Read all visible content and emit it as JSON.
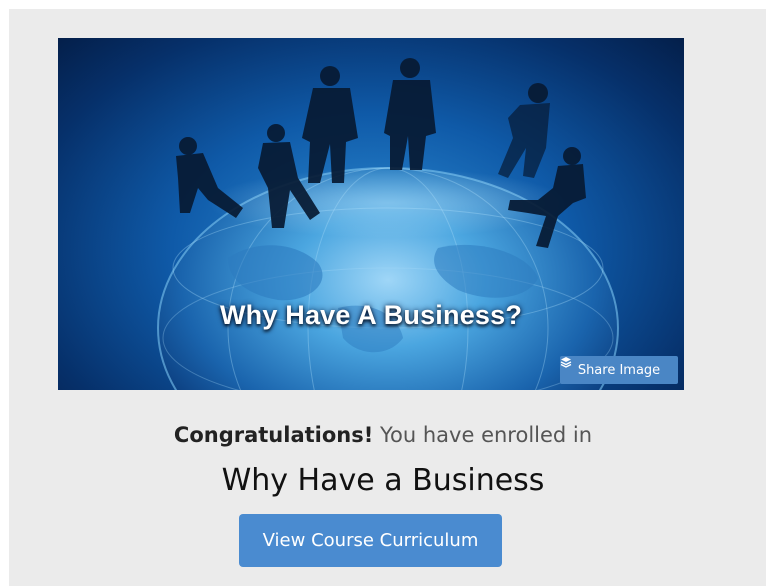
{
  "hero": {
    "caption": "Why Have A Business?",
    "share_label": "Share Image",
    "share_icon": "layers-icon"
  },
  "enrollment": {
    "congrats_strong": "Congratulations!",
    "congrats_rest": " You have enrolled in",
    "course_title": "Why Have a Business",
    "curriculum_button": "View Course Curriculum"
  },
  "colors": {
    "panel_bg": "#ebebeb",
    "button_blue": "#4a8bd0",
    "share_blue": "#4a86c5"
  }
}
